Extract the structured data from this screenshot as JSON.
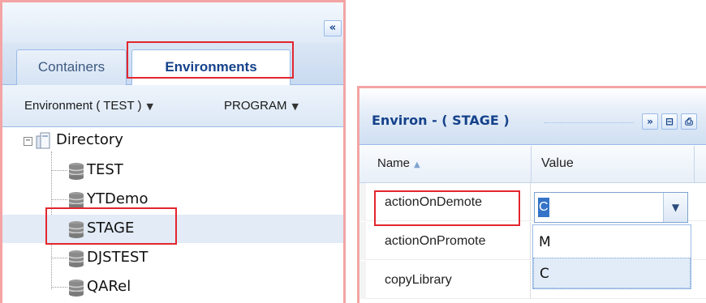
{
  "left_panel": {
    "collapse_glyph": "«",
    "tabs": [
      {
        "label": "Containers",
        "active": false
      },
      {
        "label": "Environments",
        "active": true
      }
    ],
    "toolbar": {
      "environment_menu": "Environment ( TEST )",
      "program_menu": "PROGRAM"
    },
    "tree": {
      "root": "Directory",
      "items": [
        "TEST",
        "YTDemo",
        "STAGE",
        "DJSTEST",
        "QARel"
      ],
      "selected": "STAGE"
    }
  },
  "right_panel": {
    "title": "Environ - ( STAGE )",
    "header_buttons": [
      "»",
      "⊟",
      "⎙"
    ],
    "columns": {
      "name": "Name",
      "value": "Value"
    },
    "rows": [
      {
        "name": "actionOnDemote",
        "value": "C"
      },
      {
        "name": "actionOnPromote",
        "value": ""
      },
      {
        "name": "copyLibrary",
        "value": ""
      }
    ],
    "combo": {
      "value": "C"
    },
    "dropdown_options": [
      {
        "label": "M",
        "selected": false
      },
      {
        "label": "C",
        "selected": true
      }
    ]
  },
  "colors": {
    "highlight": "#e3262e",
    "panel_border": "#f4a4a4",
    "title_blue": "#15428b",
    "selection_blue": "#3573c8"
  }
}
